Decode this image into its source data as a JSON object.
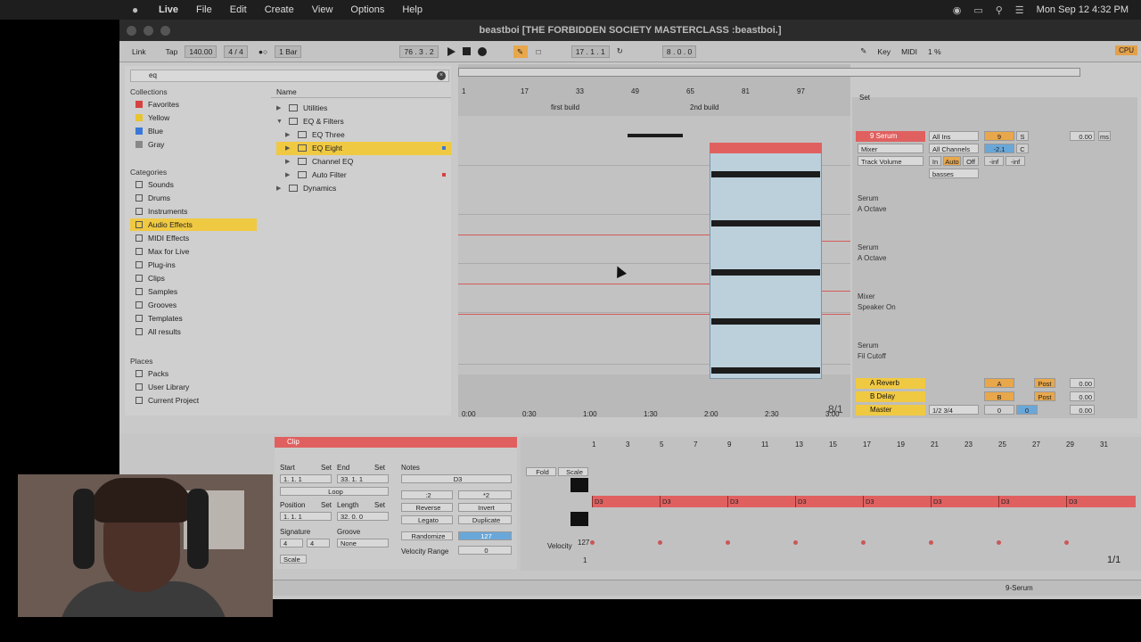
{
  "menubar": {
    "app": "Live",
    "items": [
      "File",
      "Edit",
      "Create",
      "View",
      "Options",
      "Help"
    ],
    "clock": "Mon Sep 12  4:32 PM"
  },
  "window": {
    "title": "beastboi  [THE FORBIDDEN SOCIETY MASTERCLASS :beastboi.]"
  },
  "transport": {
    "link": "Link",
    "tap": "Tap",
    "tempo": "140.00",
    "signature": "4 / 4",
    "quantize": "1 Bar",
    "position": "76 .  3 .  2",
    "loop_start": "17 .  1 .  1",
    "loop_length": "8 .  0 .  0",
    "key": "Key",
    "midi": "MIDI",
    "cpu_percent": "1 %",
    "cpu_label": "CPU"
  },
  "browser": {
    "search_value": "eq",
    "collections_label": "Collections",
    "collections": [
      {
        "label": "Favorites",
        "color": "#d94040"
      },
      {
        "label": "Yellow",
        "color": "#e8c42e"
      },
      {
        "label": "Blue",
        "color": "#3a78d8"
      },
      {
        "label": "Gray",
        "color": "#888888"
      }
    ],
    "categories_label": "Categories",
    "categories": [
      "Sounds",
      "Drums",
      "Instruments",
      "Audio Effects",
      "MIDI Effects",
      "Max for Live",
      "Plug-ins",
      "Clips",
      "Samples",
      "Grooves",
      "Templates",
      "All results"
    ],
    "selected_category": "Audio Effects",
    "places_label": "Places",
    "places": [
      "Packs",
      "User Library",
      "Current Project"
    ],
    "name_header": "Name",
    "tree": [
      {
        "label": "Utilities",
        "level": 0
      },
      {
        "label": "EQ & Filters",
        "level": 0
      },
      {
        "label": "EQ Three",
        "level": 1
      },
      {
        "label": "EQ Eight",
        "level": 1
      },
      {
        "label": "Channel EQ",
        "level": 1
      },
      {
        "label": "Auto Filter",
        "level": 1
      },
      {
        "label": "Dynamics",
        "level": 0
      }
    ],
    "selected_tree": "EQ Eight"
  },
  "arrangement": {
    "bar_marks": [
      "1",
      "17",
      "33",
      "49",
      "65",
      "81",
      "97"
    ],
    "locators": [
      "first build",
      "2nd build"
    ],
    "time_marks": [
      "0:00",
      "0:30",
      "1:00",
      "1:30",
      "2:00",
      "2:30",
      "3:00"
    ],
    "zoom_fraction": "8/1"
  },
  "mixer": {
    "set_label": "Set",
    "track_name": "9 Serum",
    "track_number": "9",
    "mixer_select": "Mixer",
    "param_select": "Track Volume",
    "input_select": "All Ins",
    "channel_select": "All Channels",
    "monitor_in": "In",
    "monitor_auto": "Auto",
    "monitor_off": "Off",
    "pan_value": "-2.1",
    "center": "C",
    "neg_inf_1": "-inf",
    "neg_inf_2": "-inf",
    "group_select": "basses",
    "volume": "0.00",
    "ms": "ms",
    "solo": "S",
    "auto_lanes": [
      {
        "device": "Serum",
        "param": "A Octave"
      },
      {
        "device": "Serum",
        "param": "A Octave"
      },
      {
        "device": "Mixer",
        "param": "Speaker On"
      },
      {
        "device": "Serum",
        "param": "Fil Cutoff"
      }
    ],
    "returns": [
      {
        "name": "A Reverb",
        "letter": "A",
        "post": "Post",
        "vol": "0.00"
      },
      {
        "name": "B Delay",
        "letter": "B",
        "post": "Post",
        "vol": "0.00"
      }
    ],
    "master": {
      "name": "Master",
      "cue": "1/2 3/4",
      "a": "0",
      "b": "0",
      "vol": "0.00"
    }
  },
  "clip_panel": {
    "title": "Clip",
    "start_label": "Start",
    "end_label": "End",
    "set_label": "Set",
    "start_value": "1.  1.  1",
    "end_value": "33.  1.  1",
    "loop_label": "Loop",
    "position_label": "Position",
    "length_label": "Length",
    "position_value": "1.  1.  1",
    "length_value": "32.  0.  0",
    "signature_label": "Signature",
    "groove_label": "Groove",
    "sig_num": "4",
    "sig_den": "4",
    "groove_value": "None",
    "scale_label": "Scale",
    "notes_label": "Notes",
    "note_value": "D3",
    "half": ":2",
    "double": "*2",
    "reverse": "Reverse",
    "invert": "Invert",
    "legato": "Legato",
    "duplicate": "Duplicate",
    "randomize": "Randomize",
    "rand_value": "127",
    "velocity_range_label": "Velocity Range",
    "velocity_range_value": "0"
  },
  "midi_editor": {
    "fold": "Fold",
    "scale": "Scale",
    "bar_marks": [
      "1",
      "3",
      "5",
      "7",
      "9",
      "11",
      "13",
      "15",
      "17",
      "19",
      "21",
      "23",
      "25",
      "27",
      "29",
      "31"
    ],
    "notes": [
      "D3",
      "D3",
      "D3",
      "D3",
      "D3",
      "D3",
      "D3",
      "D3"
    ],
    "velocity_label": "Velocity",
    "velocity_max": "127",
    "velocity_min": "1",
    "page": "1/1"
  },
  "bottombar": {
    "track_label": "9-Serum"
  },
  "colors": {
    "accent_red": "#e06060",
    "highlight_yellow": "#f0c942",
    "active_blue": "#6aa7d9",
    "button_orange": "#e8a74b"
  }
}
